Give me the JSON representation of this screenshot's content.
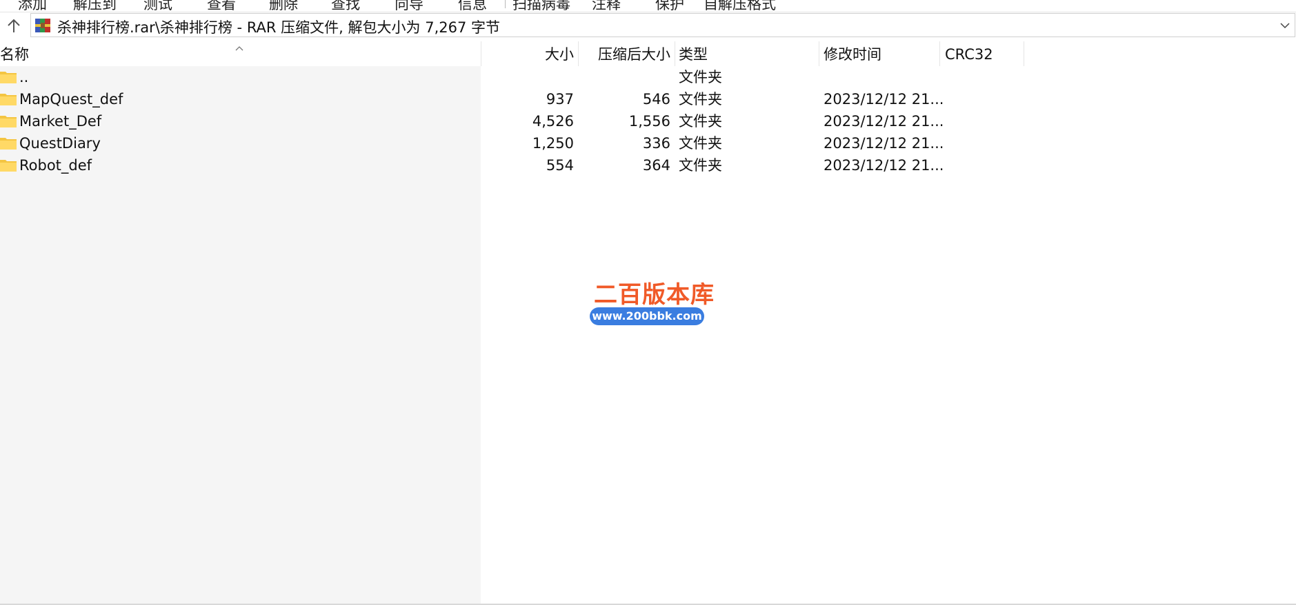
{
  "toolbar": {
    "items": [
      "添加",
      "解压到",
      "测试",
      "查看",
      "删除",
      "查找",
      "向导",
      "信息",
      "扫描病毒",
      "注释",
      "保护",
      "自解压格式"
    ]
  },
  "address": {
    "path": "杀神排行榜.rar\\杀神排行榜 - RAR 压缩文件, 解包大小为 7,267 字节"
  },
  "columns": {
    "name": "名称",
    "size": "大小",
    "packed": "压缩后大小",
    "type": "类型",
    "modified": "修改时间",
    "crc": "CRC32"
  },
  "rows": [
    {
      "name": "..",
      "size": "",
      "packed": "",
      "type": "文件夹",
      "modified": ""
    },
    {
      "name": "MapQuest_def",
      "size": "937",
      "packed": "546",
      "type": "文件夹",
      "modified": "2023/12/12 21..."
    },
    {
      "name": "Market_Def",
      "size": "4,526",
      "packed": "1,556",
      "type": "文件夹",
      "modified": "2023/12/12 21..."
    },
    {
      "name": "QuestDiary",
      "size": "1,250",
      "packed": "336",
      "type": "文件夹",
      "modified": "2023/12/12 21..."
    },
    {
      "name": "Robot_def",
      "size": "554",
      "packed": "364",
      "type": "文件夹",
      "modified": "2023/12/12 21..."
    }
  ],
  "watermark": {
    "title": "二百版本库",
    "url": "www.200bbk.com"
  },
  "colors": {
    "folder": "#f4c542",
    "watermark_title": "#f05a28",
    "watermark_pill": "#3a7de0"
  },
  "icons": {
    "up": "arrow-up-icon",
    "archive": "rar-archive-icon",
    "folder": "folder-icon",
    "dropdown": "chevron-down-icon"
  }
}
